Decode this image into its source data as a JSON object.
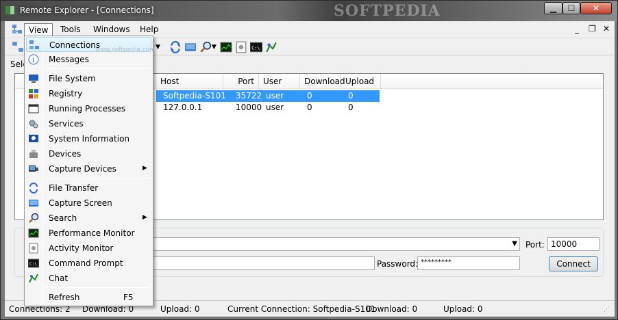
{
  "window": {
    "title": "Remote Explorer - [Connections]",
    "watermark": "SOFTPEDIA"
  },
  "menubar": {
    "items": [
      "View",
      "Tools",
      "Windows",
      "Help"
    ]
  },
  "left_panel": {
    "selection_label": "Sele"
  },
  "view_menu": {
    "watermark": "www.softpedia.com",
    "items": [
      {
        "label": "Connections",
        "icon": "network-icon"
      },
      {
        "label": "Messages",
        "icon": "info-icon"
      },
      {
        "label": "File System",
        "icon": "computer-icon"
      },
      {
        "label": "Registry",
        "icon": "registry-icon"
      },
      {
        "label": "Running Processes",
        "icon": "window-icon"
      },
      {
        "label": "Services",
        "icon": "gears-icon"
      },
      {
        "label": "System Information",
        "icon": "system-info-icon"
      },
      {
        "label": "Devices",
        "icon": "devices-icon"
      },
      {
        "label": "Capture Devices",
        "icon": "capture-devices-icon"
      },
      {
        "label": "File Transfer",
        "icon": "transfer-icon"
      },
      {
        "label": "Capture Screen",
        "icon": "screen-icon"
      },
      {
        "label": "Search",
        "icon": "magnifier-icon"
      },
      {
        "label": "Performance Monitor",
        "icon": "performance-icon"
      },
      {
        "label": "Activity Monitor",
        "icon": "activity-icon"
      },
      {
        "label": "Command Prompt",
        "icon": "console-icon"
      },
      {
        "label": "Chat",
        "icon": "chat-icon"
      },
      {
        "label": "Refresh",
        "icon": "",
        "shortcut": "F5"
      }
    ]
  },
  "connections_table": {
    "columns": [
      "Host",
      "Port",
      "User",
      "Download",
      "Upload"
    ],
    "rows": [
      {
        "host": "Softpedia-S101",
        "port": "35722",
        "user": "user",
        "download": "0",
        "upload": "0"
      },
      {
        "host": "127.0.0.1",
        "port": "10000",
        "user": "user",
        "download": "0",
        "upload": "0"
      }
    ]
  },
  "connect_form": {
    "port_label": "Port:",
    "port_value": "10000",
    "password_label": "Password:",
    "password_value": "*********",
    "connect_label": "Connect"
  },
  "statusbar": {
    "connections": "Connections: 2",
    "download": "Download: 0",
    "upload": "Upload: 0",
    "current_connection": "Current Connection:  Softpedia-S101",
    "cur_download": "Download: 0",
    "cur_upload": "Upload: 0"
  },
  "colors": {
    "selection": "#3399ff",
    "menu_highlight": "#d9f0fc"
  }
}
